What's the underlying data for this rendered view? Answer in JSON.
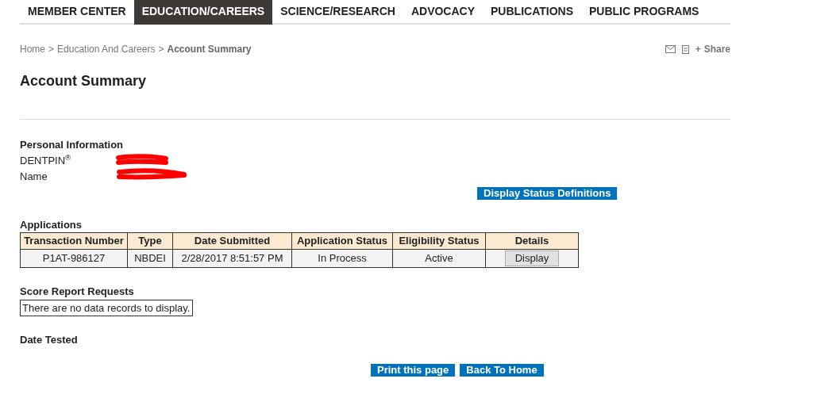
{
  "nav": [
    {
      "label": "MEMBER CENTER",
      "selected": false
    },
    {
      "label": "EDUCATION/CAREERS",
      "selected": true
    },
    {
      "label": "SCIENCE/RESEARCH",
      "selected": false
    },
    {
      "label": "ADVOCACY",
      "selected": false
    },
    {
      "label": "PUBLICATIONS",
      "selected": false
    },
    {
      "label": "PUBLIC PROGRAMS",
      "selected": false
    }
  ],
  "breadcrumb": [
    {
      "label": "Home",
      "current": false
    },
    {
      "label": "Education And Careers",
      "current": false
    },
    {
      "label": "Account Summary",
      "current": true
    }
  ],
  "breadcrumb_separator": ">",
  "share": {
    "plus": "+",
    "label": "Share"
  },
  "title": "Account Summary",
  "personal_information": {
    "heading": "Personal Information",
    "fields": [
      {
        "label": "DENTPIN$^{®}$"
      },
      {
        "label": "Name"
      }
    ]
  },
  "status_definitions_button": "Display Status Definitions",
  "applications": {
    "heading": "Applications",
    "columns": [
      "Transaction Number",
      "Type",
      "Date Submitted",
      "Application Status",
      "Eligibility Status",
      "Details"
    ],
    "rows": [
      {
        "cells": [
          "P1AT-986127",
          "NBDEI",
          "2/28/2017 8:51:57 PM",
          "In Process",
          "Active"
        ],
        "button": "Display"
      }
    ]
  },
  "score_reports": {
    "heading": "Score Report Requests",
    "empty_message": "There are no data records to display."
  },
  "date_tested": {
    "heading": "Date Tested"
  },
  "footer_buttons": [
    "Print this page",
    "Back To Home"
  ]
}
